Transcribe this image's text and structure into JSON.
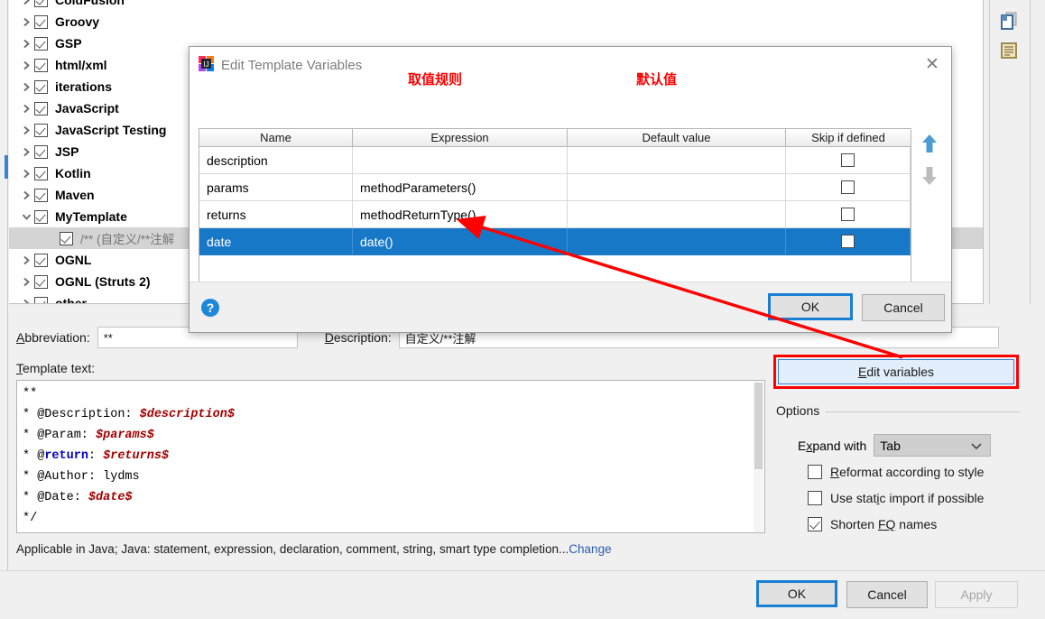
{
  "tree": {
    "items": [
      {
        "label": "ColdFusion",
        "expanded": false,
        "checked": true,
        "child": false,
        "selected": false,
        "cut_top": true
      },
      {
        "label": "Groovy",
        "expanded": false,
        "checked": true,
        "child": false,
        "selected": false
      },
      {
        "label": "GSP",
        "expanded": false,
        "checked": true,
        "child": false,
        "selected": false
      },
      {
        "label": "html/xml",
        "expanded": false,
        "checked": true,
        "child": false,
        "selected": false
      },
      {
        "label": "iterations",
        "expanded": false,
        "checked": true,
        "child": false,
        "selected": false
      },
      {
        "label": "JavaScript",
        "expanded": false,
        "checked": true,
        "child": false,
        "selected": false
      },
      {
        "label": "JavaScript Testing",
        "expanded": false,
        "checked": true,
        "child": false,
        "selected": false
      },
      {
        "label": "JSP",
        "expanded": false,
        "checked": true,
        "child": false,
        "selected": false
      },
      {
        "label": "Kotlin",
        "expanded": false,
        "checked": true,
        "child": false,
        "selected": false
      },
      {
        "label": "Maven",
        "expanded": false,
        "checked": true,
        "child": false,
        "selected": false
      },
      {
        "label": "MyTemplate",
        "expanded": true,
        "checked": true,
        "child": false,
        "selected": false
      },
      {
        "label": "/** (自定义/**注解",
        "expanded": null,
        "checked": true,
        "child": true,
        "selected": true
      },
      {
        "label": "OGNL",
        "expanded": false,
        "checked": true,
        "child": false,
        "selected": false
      },
      {
        "label": "OGNL (Struts 2)",
        "expanded": false,
        "checked": true,
        "child": false,
        "selected": false
      },
      {
        "label": "other",
        "expanded": false,
        "checked": true,
        "child": false,
        "selected": false,
        "cut_bottom": true
      }
    ]
  },
  "side_icons": {
    "copy_label": "copy-template-icon",
    "note_label": "template-description-icon"
  },
  "fields": {
    "abbreviation_label": "Abbreviation:",
    "abbreviation_mnemonic": "A",
    "abbreviation_value": "**",
    "description_label": "Description:",
    "description_mnemonic": "D",
    "description_value": "自定义/**注解"
  },
  "template_text": {
    "label": "Template text:",
    "mnemonic": "T",
    "lines": [
      {
        "plain": "**"
      },
      {
        "prefix": "* @Description: ",
        "var": "$description$"
      },
      {
        "prefix": "* @Param: ",
        "var": "$params$"
      },
      {
        "prefix": "* @",
        "keyword": "return",
        "mid": ": ",
        "var": "$returns$"
      },
      {
        "plain": "* @Author: lydms"
      },
      {
        "prefix": "* @Date: ",
        "var": "$date$"
      },
      {
        "plain": "*/"
      }
    ]
  },
  "applicable": {
    "text": "Applicable in Java; Java: statement, expression, declaration, comment, string, smart type completion...",
    "change_link": "Change"
  },
  "edit_variables": {
    "label": "Edit variables",
    "mnemonic": "E",
    "highlight_color": "#ff0000"
  },
  "options": {
    "title": "Options",
    "expand_with_label": "Expand with",
    "expand_with_mnemonic": "x",
    "expand_with_value": "Tab",
    "checkboxes": [
      {
        "label": "Reformat according to style",
        "mnemonic": "R",
        "checked": false
      },
      {
        "label": "Use static import if possible",
        "mnemonic": "i",
        "checked": false
      },
      {
        "label": "Shorten FQ names",
        "mnemonic": "FQ",
        "checked": true
      }
    ]
  },
  "bottom_buttons": {
    "ok": "OK",
    "cancel": "Cancel",
    "apply": "Apply",
    "apply_enabled": false
  },
  "dialog": {
    "title": "Edit Template Variables",
    "app_icon": "intellij-idea-icon",
    "close_icon": "close-icon",
    "help_icon": "help-icon",
    "columns": [
      "Name",
      "Expression",
      "Default value",
      "Skip if defined"
    ],
    "rows": [
      {
        "name": "description",
        "expression": "",
        "default_value": "",
        "skip_if_defined": false,
        "selected": false
      },
      {
        "name": "params",
        "expression": "methodParameters()",
        "default_value": "",
        "skip_if_defined": false,
        "selected": false
      },
      {
        "name": "returns",
        "expression": "methodReturnType()",
        "default_value": "",
        "skip_if_defined": false,
        "selected": false
      },
      {
        "name": "date",
        "expression": "date()",
        "default_value": "",
        "skip_if_defined": false,
        "selected": true
      }
    ],
    "move_up_icon": "arrow-up-icon",
    "move_down_icon": "arrow-down-icon",
    "move_up_enabled": true,
    "move_down_enabled": false,
    "ok": "OK",
    "cancel": "Cancel"
  },
  "annotations": {
    "expression_note": "取值规则",
    "default_value_note": "默认值",
    "arrow_color": "#ff0000"
  }
}
